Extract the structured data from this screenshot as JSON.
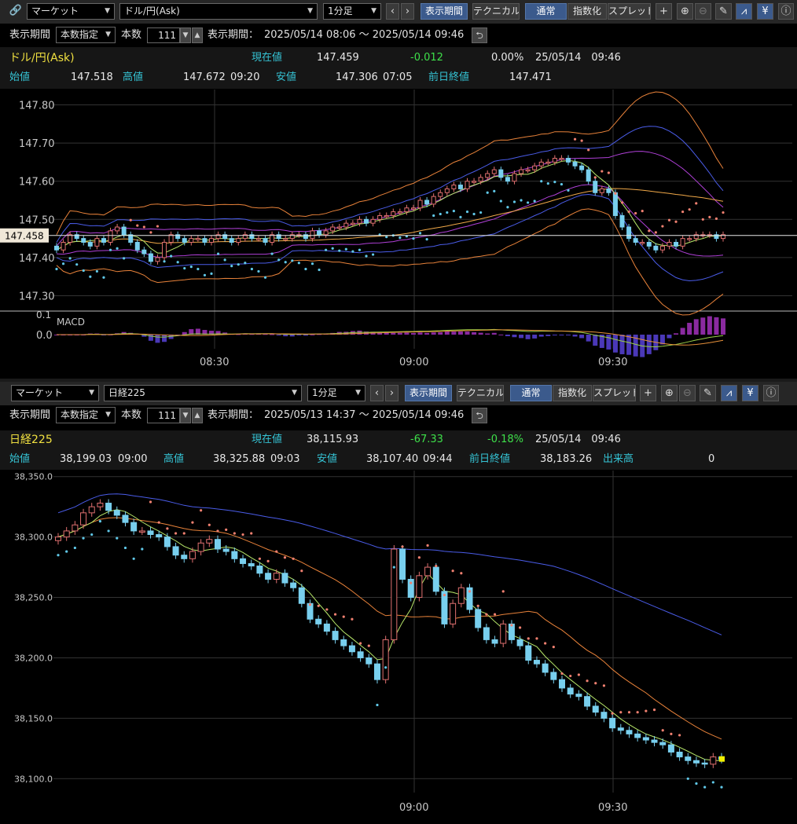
{
  "top": {
    "toolbar": {
      "market_select": "マーケット",
      "symbol_select": "ドル/円(Ask)",
      "period_select": "1分足",
      "prev_icon": "‹",
      "next_icon": "›",
      "display_period_btn": "表示期間",
      "technical_btn": "テクニカル",
      "normal_btn": "通常",
      "index_btn": "指数化",
      "spread_btn": "スプレッド"
    },
    "range": {
      "label": "表示期間",
      "mode": "本数指定",
      "count_label": "本数",
      "count": "111",
      "period_label": "表示期間：",
      "period": "2025/05/14 08:06 〜 2025/05/14 09:46"
    },
    "quote": {
      "name": "ドル/円(Ask)",
      "current_label": "現在値",
      "current": "147.459",
      "change": "-0.012",
      "change_pct": "0.00%",
      "datetime": "25/05/14　09:46"
    },
    "ohlc": {
      "open_label": "始値",
      "open": "147.518",
      "high_label": "高値",
      "high": "147.672",
      "high_time": "09:20",
      "low_label": "安値",
      "low": "147.306",
      "low_time": "07:05",
      "prev_label": "前日終値",
      "prev": "147.471"
    },
    "price_tag": "147.458",
    "macd_label": "MACD",
    "macd_ticks": [
      "0.1",
      "0.0"
    ],
    "xticks": [
      "08:30",
      "09:00",
      "09:30"
    ]
  },
  "bottom": {
    "toolbar": {
      "market_select": "マーケット",
      "symbol_select": "日経225",
      "period_select": "1分足",
      "prev_icon": "‹",
      "next_icon": "›",
      "display_period_btn": "表示期間",
      "technical_btn": "テクニカル",
      "normal_btn": "通常",
      "index_btn": "指数化",
      "spread_btn": "スプレッド"
    },
    "range": {
      "label": "表示期間",
      "mode": "本数指定",
      "count_label": "本数",
      "count": "111",
      "period_label": "表示期間：",
      "period": "2025/05/13 14:37 〜 2025/05/14 09:46"
    },
    "quote": {
      "name": "日経225",
      "current_label": "現在値",
      "current": "38,115.93",
      "change": "-67.33",
      "change_pct": "-0.18%",
      "datetime": "25/05/14　09:46"
    },
    "ohlc": {
      "open_label": "始値",
      "open": "38,199.03",
      "open_time": "09:00",
      "high_label": "高値",
      "high": "38,325.88",
      "high_time": "09:03",
      "low_label": "安値",
      "low": "38,107.40",
      "low_time": "09:44",
      "prev_label": "前日終値",
      "prev": "38,183.26",
      "volume_label": "出来高",
      "volume": "0"
    },
    "xticks": [
      "09:00",
      "09:30"
    ]
  },
  "chart_data": [
    {
      "type": "candlestick",
      "title": "ドル/円(Ask)",
      "yticks": [
        "147.80",
        "147.70",
        "147.60",
        "147.50",
        "147.40",
        "147.30"
      ],
      "ylim": [
        147.26,
        147.84
      ],
      "grid": true,
      "x_ticks": [
        "08:30",
        "09:00",
        "09:30"
      ],
      "close": [
        147.42,
        147.44,
        147.46,
        147.45,
        147.44,
        147.43,
        147.45,
        147.44,
        147.47,
        147.48,
        147.46,
        147.44,
        147.42,
        147.41,
        147.39,
        147.4,
        147.44,
        147.46,
        147.45,
        147.44,
        147.45,
        147.45,
        147.44,
        147.45,
        147.46,
        147.45,
        147.44,
        147.45,
        147.46,
        147.45,
        147.45,
        147.44,
        147.46,
        147.45,
        147.45,
        147.46,
        147.46,
        147.45,
        147.47,
        147.46,
        147.47,
        147.48,
        147.48,
        147.49,
        147.49,
        147.5,
        147.49,
        147.5,
        147.51,
        147.51,
        147.52,
        147.52,
        147.53,
        147.53,
        147.55,
        147.54,
        147.56,
        147.57,
        147.58,
        147.59,
        147.58,
        147.6,
        147.6,
        147.61,
        147.62,
        147.63,
        147.61,
        147.6,
        147.62,
        147.63,
        147.63,
        147.64,
        147.65,
        147.65,
        147.66,
        147.66,
        147.65,
        147.64,
        147.63,
        147.6,
        147.57,
        147.58,
        147.57,
        147.51,
        147.48,
        147.45,
        147.44,
        147.44,
        147.43,
        147.42,
        147.43,
        147.44,
        147.43,
        147.45,
        147.45,
        147.46,
        147.46,
        147.46,
        147.45,
        147.46
      ]
    },
    {
      "type": "candlestick",
      "title": "日経225",
      "yticks": [
        "38,350.0",
        "38,300.0",
        "38,250.0",
        "38,200.0",
        "38,150.0",
        "38,100.0"
      ],
      "ylim": [
        38095,
        38355
      ],
      "grid": true,
      "x_ticks": [
        "09:00",
        "09:30"
      ],
      "close": [
        38300,
        38305,
        38310,
        38320,
        38325,
        38328,
        38322,
        38318,
        38312,
        38305,
        38305,
        38302,
        38300,
        38292,
        38285,
        38282,
        38288,
        38295,
        38298,
        38290,
        38288,
        38282,
        38278,
        38276,
        38270,
        38265,
        38270,
        38262,
        38258,
        38245,
        38232,
        38228,
        38222,
        38215,
        38210,
        38205,
        38200,
        38195,
        38182,
        38215,
        38290,
        38265,
        38250,
        38268,
        38275,
        38255,
        38228,
        38245,
        38258,
        38240,
        38225,
        38215,
        38212,
        38228,
        38215,
        38210,
        38198,
        38195,
        38188,
        38182,
        38175,
        38170,
        38168,
        38160,
        38155,
        38150,
        38142,
        38140,
        38137,
        38134,
        38132,
        38130,
        38128,
        38122,
        38118,
        38115,
        38113,
        38112,
        38118,
        38116
      ]
    }
  ]
}
